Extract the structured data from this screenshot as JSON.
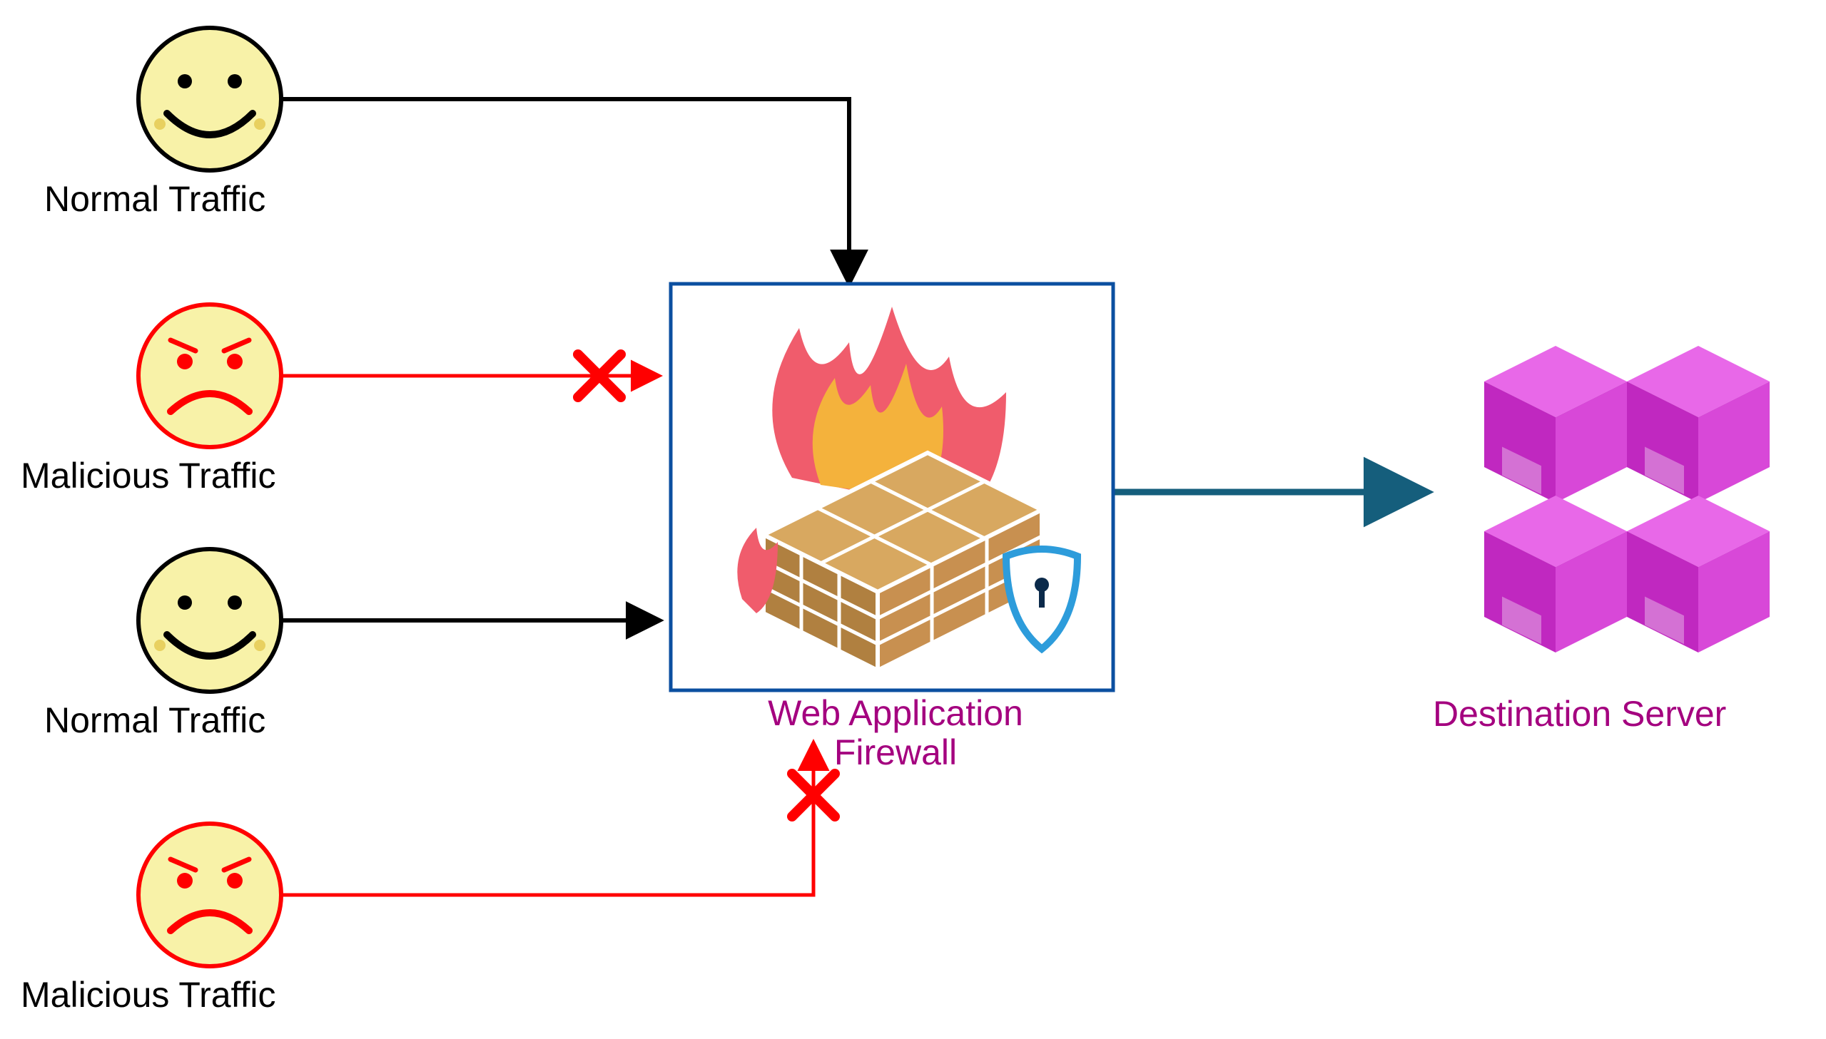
{
  "nodes": {
    "normal_traffic_1": {
      "label": "Normal Traffic"
    },
    "malicious_traffic_1": {
      "label": "Malicious Traffic"
    },
    "normal_traffic_2": {
      "label": "Normal Traffic"
    },
    "malicious_traffic_2": {
      "label": "Malicious Traffic"
    },
    "waf": {
      "label_line1": "Web Application",
      "label_line2": "Firewall"
    },
    "destination_server": {
      "label": "Destination Server"
    }
  },
  "edges": [
    {
      "from": "normal_traffic_1",
      "to": "waf",
      "color": "#000000",
      "blocked": false
    },
    {
      "from": "malicious_traffic_1",
      "to": "waf",
      "color": "#ff0000",
      "blocked": true
    },
    {
      "from": "normal_traffic_2",
      "to": "waf",
      "color": "#000000",
      "blocked": false
    },
    {
      "from": "malicious_traffic_2",
      "to": "waf",
      "color": "#ff0000",
      "blocked": true
    },
    {
      "from": "waf",
      "to": "destination_server",
      "color": "#155e7c",
      "blocked": false
    }
  ],
  "colors": {
    "normal_face_fill": "#f8f2a8",
    "normal_face_stroke": "#000000",
    "malicious_face_fill": "#f8f2a8",
    "malicious_face_stroke": "#ff0000",
    "waf_border": "#0b4fa0",
    "waf_label": "#a4007f",
    "server_fill": "#d836d8",
    "server_label": "#a4007f",
    "fire_outer": "#f05c6c",
    "fire_inner": "#f4b23c",
    "wall_top": "#d8a860",
    "wall_front": "#b08040",
    "shield_stroke": "#2d9cdb",
    "arrow_allow": "#000000",
    "arrow_block": "#ff0000",
    "arrow_pass": "#155e7c"
  }
}
